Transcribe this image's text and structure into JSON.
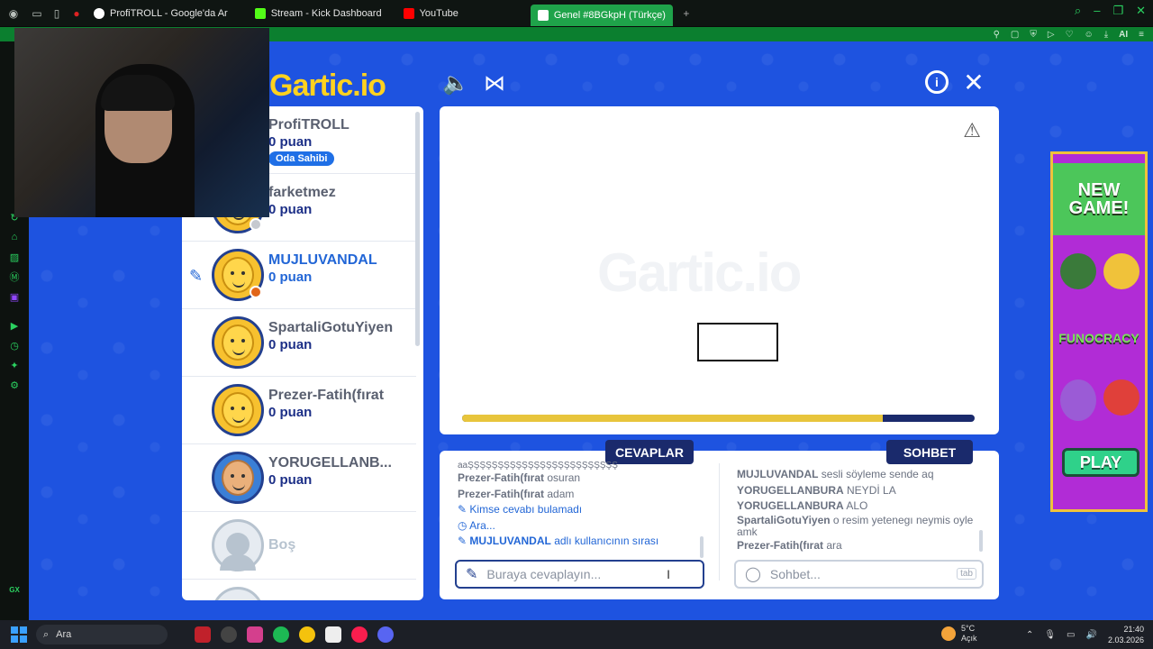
{
  "browser": {
    "tabs": [
      {
        "label": "ProfiTROLL - Google'da Ar",
        "color": "#4285f4"
      },
      {
        "label": "Stream - Kick Dashboard",
        "color": "#53fc18"
      },
      {
        "label": "YouTube",
        "color": "#ff0000"
      },
      {
        "label": "Genel #8BGkpH (Türkçe)",
        "color": "#ffffff"
      }
    ],
    "new_tab": "+",
    "ai_label": "AI"
  },
  "sidebar": {
    "gx_label": "GX"
  },
  "game": {
    "logo": "Gartic.io",
    "watermark": "Gartic.io",
    "timer_fraction": 0.82,
    "players": [
      {
        "name": "ProfiTROLL",
        "score": "0 puan",
        "badge": "Oda Sahibi"
      },
      {
        "name": "farketmez",
        "score": "0 puan"
      },
      {
        "name": "MUJLUVANDAL",
        "score": "0 puan"
      },
      {
        "name": "SpartaliGotuYiyen",
        "score": "0 puan"
      },
      {
        "name": "Prezer-Fatih(fırat",
        "score": "0 puan"
      },
      {
        "name": "YORUGELLANB...",
        "score": "0 puan"
      },
      {
        "name": "Boş",
        "score": ""
      }
    ],
    "answers": {
      "title": "CEVAPLAR",
      "partial": "aaŞŞŞŞŞŞŞŞŞŞŞŞŞŞŞŞŞŞŞŞŞŞŞŞŞ",
      "messages": [
        {
          "who": "Prezer-Fatih(fırat",
          "text": "osuran"
        },
        {
          "who": "Prezer-Fatih(fırat",
          "text": "adam"
        }
      ],
      "system": [
        {
          "icon": "pencil",
          "text": "Kimse cevabı bulamadı"
        },
        {
          "icon": "clock",
          "text": "Ara..."
        },
        {
          "icon": "pencil",
          "bold": "MUJLUVANDAL",
          "text": "adlı kullanıcının sırası"
        }
      ],
      "placeholder": "Buraya cevaplayın..."
    },
    "chat": {
      "title": "SOHBET",
      "messages": [
        {
          "who": "MUJLUVANDAL",
          "text": "sesli söyleme sende aq"
        },
        {
          "who": "YORUGELLANBURA",
          "text": "NEYDİ LA"
        },
        {
          "who": "YORUGELLANBURA",
          "text": "ALO"
        },
        {
          "who": "SpartaliGotuYiyen",
          "text": "o resim yetenegı neymis oyle amk"
        },
        {
          "who": "Prezer-Fatih(fırat",
          "text": "ara"
        }
      ],
      "placeholder": "Sohbet...",
      "tab_hint": "tab"
    }
  },
  "ad": {
    "title": "NEW GAME!",
    "brand": "FUNOCRACY",
    "cta": "PLAY"
  },
  "taskbar": {
    "search": "Ara",
    "weather_temp": "5°C",
    "weather_desc": "Açık",
    "time": "21:40",
    "date": "2.03.2026"
  }
}
